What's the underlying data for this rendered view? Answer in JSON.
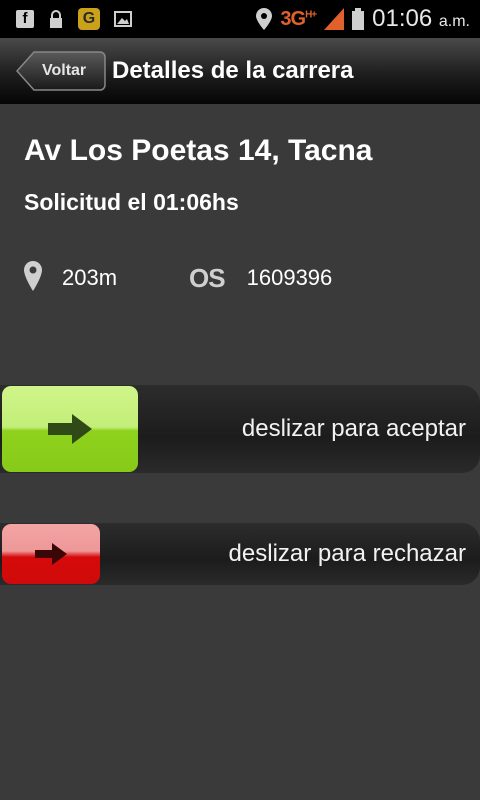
{
  "status_bar": {
    "icons": [
      "facebook-icon",
      "lock-icon",
      "app-g-icon",
      "image-icon"
    ],
    "network": "3G",
    "network_sub": "H+",
    "time": "01:06",
    "ampm": "a.m."
  },
  "action_bar": {
    "back_label": "Voltar",
    "title": "Detalles de la carrera"
  },
  "trip": {
    "address": "Av Los Poetas 14, Tacna",
    "requested": "Solicitud el 01:06hs",
    "distance": "203m",
    "os_label": "OS",
    "os_value": "1609396"
  },
  "accept_slider": {
    "label": "deslizar para aceptar",
    "color": "#8fd21e"
  },
  "reject_slider": {
    "label": "deslizar para rechazar",
    "color": "#d60a0a"
  }
}
